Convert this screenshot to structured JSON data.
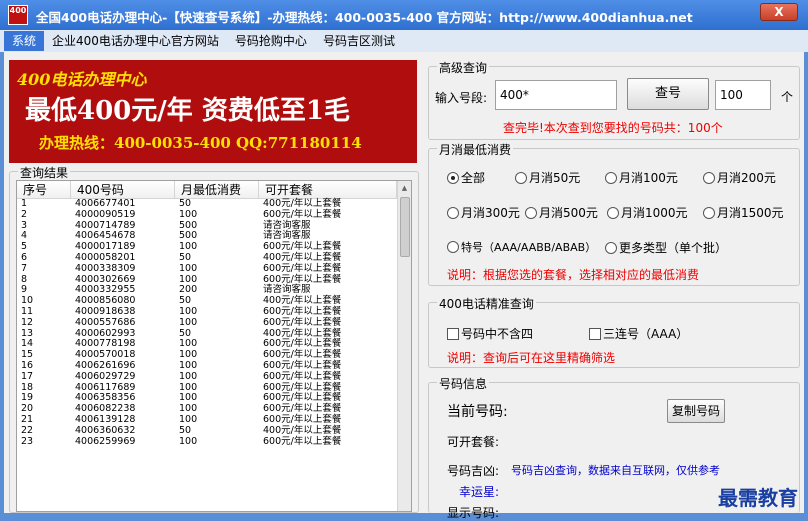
{
  "window": {
    "title": "全国400电话办理中心-【快速查号系统】-办理热线：400-0035-400 官方网站：http://www.400dianhua.net",
    "icon_text": "400",
    "close_label": "X"
  },
  "menu": [
    "系统",
    "企业400电话办理中心官方网站",
    "号码抢购中心",
    "号码吉区测试"
  ],
  "banner": {
    "line1": "400电话办理中心",
    "line2": "最低400元/年  资费低至1毛",
    "line3": "办理热线：400-0035-400 QQ:771180114"
  },
  "results": {
    "group_title": "查询结果",
    "columns": [
      "序号",
      "400号码",
      "月最低消费",
      "可开套餐"
    ],
    "rows": [
      [
        "1",
        "4006677401",
        "50",
        "400元/年以上套餐"
      ],
      [
        "2",
        "4000090519",
        "100",
        "600元/年以上套餐"
      ],
      [
        "3",
        "4000714789",
        "500",
        "请咨询客服"
      ],
      [
        "4",
        "4006454678",
        "500",
        "请咨询客服"
      ],
      [
        "5",
        "4000017189",
        "100",
        "600元/年以上套餐"
      ],
      [
        "6",
        "4000058201",
        "50",
        "400元/年以上套餐"
      ],
      [
        "7",
        "4000338309",
        "100",
        "600元/年以上套餐"
      ],
      [
        "8",
        "4000302669",
        "100",
        "600元/年以上套餐"
      ],
      [
        "9",
        "4000332955",
        "200",
        "请咨询客服"
      ],
      [
        "10",
        "4000856080",
        "50",
        "400元/年以上套餐"
      ],
      [
        "11",
        "4000918638",
        "100",
        "600元/年以上套餐"
      ],
      [
        "12",
        "4000557686",
        "100",
        "600元/年以上套餐"
      ],
      [
        "13",
        "4000602993",
        "50",
        "400元/年以上套餐"
      ],
      [
        "14",
        "4000778198",
        "100",
        "600元/年以上套餐"
      ],
      [
        "15",
        "4000570018",
        "100",
        "600元/年以上套餐"
      ],
      [
        "16",
        "4006261696",
        "100",
        "600元/年以上套餐"
      ],
      [
        "17",
        "4006029729",
        "100",
        "600元/年以上套餐"
      ],
      [
        "18",
        "4006117689",
        "100",
        "600元/年以上套餐"
      ],
      [
        "19",
        "4006358356",
        "100",
        "600元/年以上套餐"
      ],
      [
        "20",
        "4006082238",
        "100",
        "600元/年以上套餐"
      ],
      [
        "21",
        "4006139128",
        "100",
        "600元/年以上套餐"
      ],
      [
        "22",
        "4006360632",
        "50",
        "400元/年以上套餐"
      ],
      [
        "23",
        "4006259969",
        "100",
        "600元/年以上套餐"
      ]
    ]
  },
  "advanced": {
    "group_title": "高级查询",
    "input_label": "输入号段:",
    "input_value": "400*",
    "query_button": "查号",
    "count_value": "100",
    "count_unit": "个",
    "result_msg": "查完毕!本次查到您要找的号码共：100个"
  },
  "monthly": {
    "group_title": "月消最低消费",
    "options": [
      "全部",
      "月消50元",
      "月消100元",
      "月消200元",
      "月消300元",
      "月消500元",
      "月消1000元",
      "月消1500元",
      "特号（AAA/AABB/ABAB）",
      "更多类型（单个批）"
    ],
    "selected": "全部",
    "note": "说明：根据您选的套餐，选择相对应的最低消费"
  },
  "precise": {
    "group_title": "400电话精准查询",
    "opt1": "号码中不含四",
    "opt2": "三连号（AAA）",
    "note": "说明：查询后可在这里精确筛选"
  },
  "info": {
    "group_title": "号码信息",
    "current_label": "当前号码:",
    "copy_button": "复制号码",
    "package_label": "可开套餐:",
    "luck_label": "号码吉凶:",
    "luck_text": "号码吉凶查询，数据来自互联网，仅供参考",
    "lucky_label": "幸运星:",
    "display_label": "显示号码:"
  },
  "watermark": "最需教育"
}
